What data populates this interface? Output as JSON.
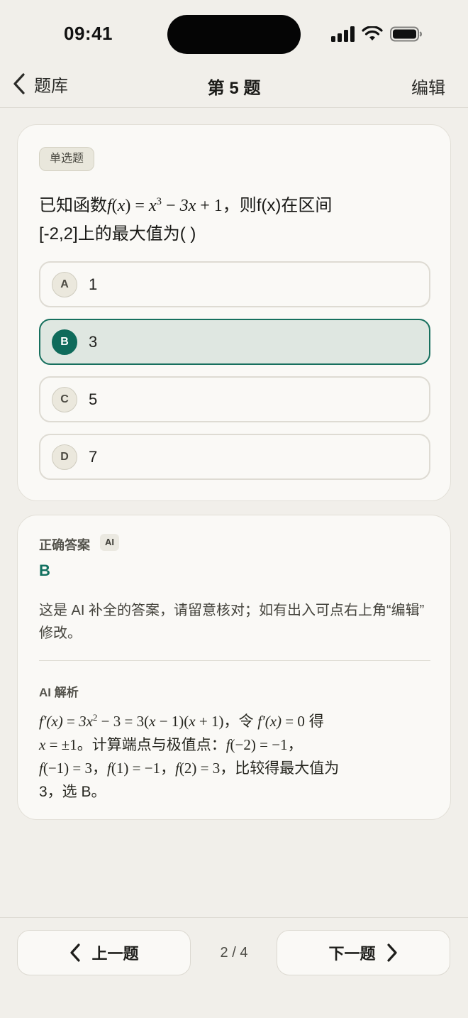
{
  "status": {
    "time": "09:41"
  },
  "nav": {
    "back_label": "题库",
    "title": "第 5 题",
    "edit_label": "编辑"
  },
  "question": {
    "type": "单选题",
    "prefix": "已知函数",
    "math": {
      "f": "f",
      "x": "x",
      "three_x": "3x",
      "one": "1",
      "exp": "3"
    },
    "suffix_line1": "，则f(x)在区间",
    "line2": "[-2,2]上的最大值为(   )",
    "options": [
      {
        "letter": "A",
        "text": "1",
        "selected": false
      },
      {
        "letter": "B",
        "text": "3",
        "selected": true
      },
      {
        "letter": "C",
        "text": "5",
        "selected": false
      },
      {
        "letter": "D",
        "text": "7",
        "selected": false
      }
    ]
  },
  "answer": {
    "label": "正确答案",
    "ai_badge": "AI",
    "value": "B",
    "note": "这是 AI 补全的答案，请留意核对；如有出入可点右上角“编辑” 修改。",
    "analysis_label": "AI 解析",
    "analysis": {
      "t1": "，令 ",
      "t2": " 得",
      "t3": "。计算端点与极值点：",
      "t4": "，",
      "t5": "，",
      "t6": "，",
      "t7": "，比较得最大值为",
      "t8": "3，选 B。"
    }
  },
  "pager": {
    "prev_label": "上一题",
    "next_label": "下一题",
    "indicator": "2 / 4"
  },
  "colors": {
    "accent": "#0f6b5b",
    "background": "#f1efea",
    "card": "#faf9f6"
  }
}
